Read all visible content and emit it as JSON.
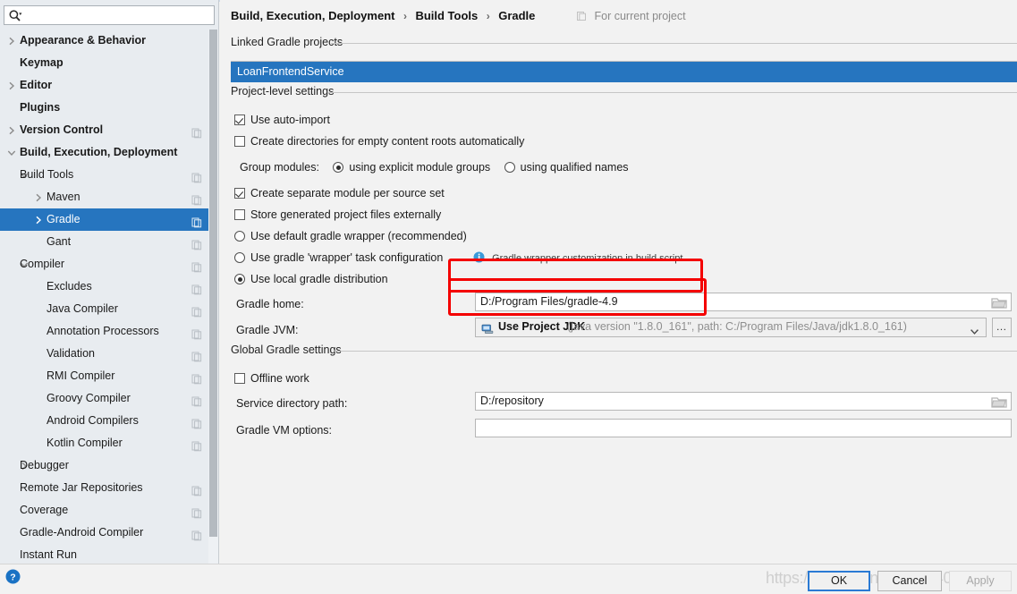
{
  "search": {
    "placeholder": "",
    "value": "",
    "icon": "search-icon"
  },
  "sidebar": {
    "items": [
      {
        "label": "Appearance & Behavior",
        "indent": 1,
        "arrow": "right",
        "bold": true,
        "badge": false,
        "selected": false
      },
      {
        "label": "Keymap",
        "indent": 2,
        "arrow": "none",
        "bold": true,
        "badge": false,
        "selected": false
      },
      {
        "label": "Editor",
        "indent": 1,
        "arrow": "right",
        "bold": true,
        "badge": false,
        "selected": false
      },
      {
        "label": "Plugins",
        "indent": 2,
        "arrow": "none",
        "bold": true,
        "badge": false,
        "selected": false
      },
      {
        "label": "Version Control",
        "indent": 1,
        "arrow": "right",
        "bold": true,
        "badge": true,
        "selected": false
      },
      {
        "label": "Build, Execution, Deployment",
        "indent": 1,
        "arrow": "down",
        "bold": true,
        "badge": false,
        "selected": false
      },
      {
        "label": "Build Tools",
        "indent": 2,
        "arrow": "down",
        "bold": false,
        "badge": true,
        "selected": false
      },
      {
        "label": "Maven",
        "indent": 3,
        "arrow": "right",
        "bold": false,
        "badge": true,
        "selected": false
      },
      {
        "label": "Gradle",
        "indent": 3,
        "arrow": "right",
        "bold": false,
        "badge": true,
        "selected": true
      },
      {
        "label": "Gant",
        "indent": 4,
        "arrow": "none",
        "bold": false,
        "badge": true,
        "selected": false
      },
      {
        "label": "Compiler",
        "indent": 2,
        "arrow": "down",
        "bold": false,
        "badge": true,
        "selected": false
      },
      {
        "label": "Excludes",
        "indent": 4,
        "arrow": "none",
        "bold": false,
        "badge": true,
        "selected": false
      },
      {
        "label": "Java Compiler",
        "indent": 4,
        "arrow": "none",
        "bold": false,
        "badge": true,
        "selected": false
      },
      {
        "label": "Annotation Processors",
        "indent": 4,
        "arrow": "none",
        "bold": false,
        "badge": true,
        "selected": false
      },
      {
        "label": "Validation",
        "indent": 4,
        "arrow": "none",
        "bold": false,
        "badge": true,
        "selected": false
      },
      {
        "label": "RMI Compiler",
        "indent": 4,
        "arrow": "none",
        "bold": false,
        "badge": true,
        "selected": false
      },
      {
        "label": "Groovy Compiler",
        "indent": 4,
        "arrow": "none",
        "bold": false,
        "badge": true,
        "selected": false
      },
      {
        "label": "Android Compilers",
        "indent": 4,
        "arrow": "none",
        "bold": false,
        "badge": true,
        "selected": false
      },
      {
        "label": "Kotlin Compiler",
        "indent": 4,
        "arrow": "none",
        "bold": false,
        "badge": true,
        "selected": false
      },
      {
        "label": "Debugger",
        "indent": 2,
        "arrow": "right",
        "bold": false,
        "badge": false,
        "selected": false
      },
      {
        "label": "Remote Jar Repositories",
        "indent": 2,
        "arrow": "none",
        "bold": false,
        "badge": true,
        "selected": false
      },
      {
        "label": "Coverage",
        "indent": 2,
        "arrow": "none",
        "bold": false,
        "badge": true,
        "selected": false
      },
      {
        "label": "Gradle-Android Compiler",
        "indent": 2,
        "arrow": "none",
        "bold": false,
        "badge": true,
        "selected": false
      },
      {
        "label": "Instant Run",
        "indent": 2,
        "arrow": "none",
        "bold": false,
        "badge": false,
        "selected": false
      }
    ]
  },
  "header": {
    "crumbs": [
      "Build, Execution, Deployment",
      "Build Tools",
      "Gradle"
    ],
    "separator": "›",
    "scope_label": "For current project",
    "scope_icon": "project-scope-icon"
  },
  "sections": {
    "linked_projects_title": "Linked Gradle projects",
    "project_level_title": "Project-level settings",
    "global_settings_title": "Global Gradle settings"
  },
  "linked_projects": {
    "items": [
      "LoanFrontendService"
    ],
    "selected": "LoanFrontendService"
  },
  "project_settings": {
    "use_auto_import": {
      "label": "Use auto-import",
      "checked": true
    },
    "create_dirs_empty_roots": {
      "label": "Create directories for empty content roots automatically",
      "checked": false
    },
    "group_modules_label": "Group modules:",
    "group_modules_options": [
      {
        "label": "using explicit module groups",
        "selected": true
      },
      {
        "label": "using qualified names",
        "selected": false
      }
    ],
    "create_separate_module": {
      "label": "Create separate module per source set",
      "checked": true
    },
    "store_generated_external": {
      "label": "Store generated project files externally",
      "checked": false
    },
    "distribution_options": [
      {
        "label": "Use default gradle wrapper (recommended)",
        "selected": false
      },
      {
        "label": "Use gradle 'wrapper' task configuration",
        "selected": false
      },
      {
        "label": "Use local gradle distribution",
        "selected": true
      }
    ],
    "wrapper_note": "Gradle wrapper customization in build script",
    "wrapper_note_icon": "info-icon",
    "gradle_home_label": "Gradle home:",
    "gradle_home_value": "D:/Program Files/gradle-4.9",
    "gradle_jvm_label": "Gradle JVM:",
    "gradle_jvm_main": "Use Project JDK",
    "gradle_jvm_detail": "(java version \"1.8.0_161\", path: C:/Program Files/Java/jdk1.8.0_161)",
    "gradle_jvm_icon": "jdk-icon",
    "gradle_jvm_ellipsis": "…"
  },
  "global_settings": {
    "offline_work": {
      "label": "Offline work",
      "checked": false
    },
    "service_directory_label": "Service directory path:",
    "service_directory_value": "D:/repository",
    "vm_options_label": "Gradle VM options:",
    "vm_options_value": ""
  },
  "footer": {
    "help_icon": "help-icon",
    "ok_label": "OK",
    "cancel_label": "Cancel",
    "apply_label": "Apply",
    "watermark": "https://blog.csdn.net/qq_40090255"
  },
  "colors": {
    "selection_blue": "#2675bf",
    "annotation_red": "#f40000",
    "info_blue": "#3a9ad9",
    "panel_bg": "#f2f2f2",
    "sidebar_bg": "#e8ecf0"
  }
}
